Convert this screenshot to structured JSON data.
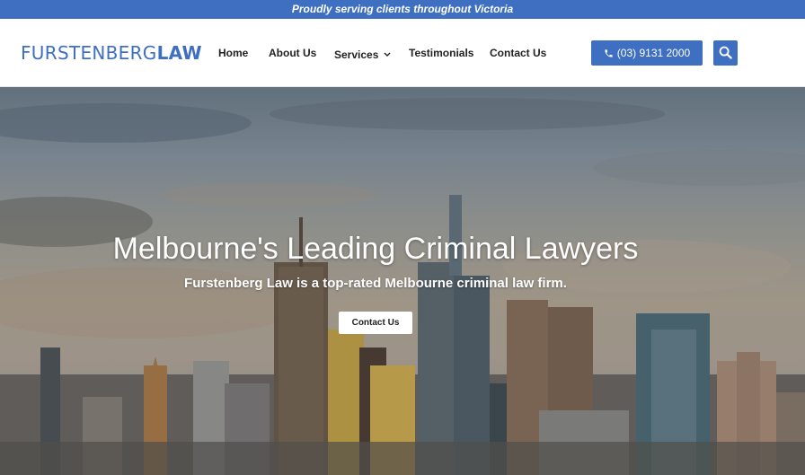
{
  "topbar": {
    "text": "Proudly serving clients throughout Victoria"
  },
  "logo": {
    "part1": "FURSTENBERG",
    "part2": "LAW"
  },
  "nav": {
    "items": [
      {
        "label": "Home"
      },
      {
        "label": "About Us"
      },
      {
        "label": "Services"
      },
      {
        "label": "Testimonials"
      },
      {
        "label": "Contact Us"
      }
    ]
  },
  "phone": {
    "label": "(03) 9131 2000",
    "icon": "phone-icon"
  },
  "search": {
    "icon": "search-icon"
  },
  "hero": {
    "title": "Melbourne's Leading Criminal Lawyers",
    "subtitle": "Furstenberg Law is a top-rated Melbourne criminal law firm.",
    "button_label": "Contact Us"
  },
  "colors": {
    "brand": "#3f6fc0",
    "text_dark": "#222222",
    "white": "#ffffff"
  }
}
